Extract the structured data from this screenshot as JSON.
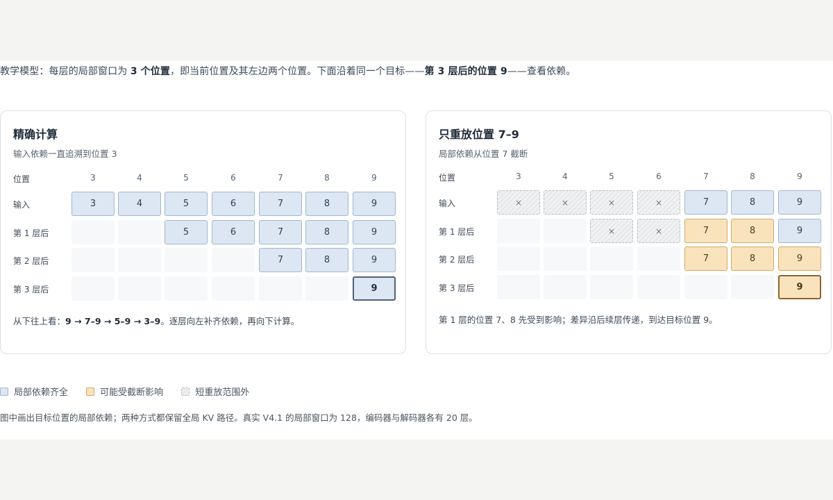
{
  "intro": {
    "p1": "教学模型：每层的局部窗口为 ",
    "b1": "3 个位置",
    "p2": "，即当前位置及其左边两个位置。下面沿着同一个目标——",
    "b2": "第 3 层后的位置 9",
    "p3": "——查看依赖。"
  },
  "column_header_label": "位置",
  "positions": [
    "3",
    "4",
    "5",
    "6",
    "7",
    "8",
    "9"
  ],
  "row_labels": [
    "输入",
    "第 1 层后",
    "第 2 层后",
    "第 3 层后"
  ],
  "panels": [
    {
      "title": "精确计算",
      "subtitle": "输入依赖一直追溯到位置 3",
      "grid": [
        [
          {
            "t": "blue",
            "v": "3"
          },
          {
            "t": "blue",
            "v": "4"
          },
          {
            "t": "blue",
            "v": "5"
          },
          {
            "t": "blue",
            "v": "6"
          },
          {
            "t": "blue",
            "v": "7"
          },
          {
            "t": "blue",
            "v": "8"
          },
          {
            "t": "blue",
            "v": "9"
          }
        ],
        [
          {
            "t": "empty",
            "v": ""
          },
          {
            "t": "empty",
            "v": ""
          },
          {
            "t": "blue",
            "v": "5"
          },
          {
            "t": "blue",
            "v": "6"
          },
          {
            "t": "blue",
            "v": "7"
          },
          {
            "t": "blue",
            "v": "8"
          },
          {
            "t": "blue",
            "v": "9"
          }
        ],
        [
          {
            "t": "empty",
            "v": ""
          },
          {
            "t": "empty",
            "v": ""
          },
          {
            "t": "empty",
            "v": ""
          },
          {
            "t": "empty",
            "v": ""
          },
          {
            "t": "blue",
            "v": "7"
          },
          {
            "t": "blue",
            "v": "8"
          },
          {
            "t": "blue",
            "v": "9"
          }
        ],
        [
          {
            "t": "empty",
            "v": ""
          },
          {
            "t": "empty",
            "v": ""
          },
          {
            "t": "empty",
            "v": ""
          },
          {
            "t": "empty",
            "v": ""
          },
          {
            "t": "empty",
            "v": ""
          },
          {
            "t": "empty",
            "v": ""
          },
          {
            "t": "target-blue",
            "v": "9"
          }
        ]
      ],
      "footer": {
        "p1": "从下往上看：",
        "b1": "9 → 7–9 → 5–9 → 3–9",
        "p2": "。逐层向左补齐依赖，再向下计算。"
      }
    },
    {
      "title": "只重放位置 7–9",
      "subtitle": "局部依赖从位置 7 截断",
      "grid": [
        [
          {
            "t": "hatch",
            "v": "×"
          },
          {
            "t": "hatch",
            "v": "×"
          },
          {
            "t": "hatch",
            "v": "×"
          },
          {
            "t": "hatch",
            "v": "×"
          },
          {
            "t": "blue",
            "v": "7"
          },
          {
            "t": "blue",
            "v": "8"
          },
          {
            "t": "blue",
            "v": "9"
          }
        ],
        [
          {
            "t": "empty",
            "v": ""
          },
          {
            "t": "empty",
            "v": ""
          },
          {
            "t": "hatch",
            "v": "×"
          },
          {
            "t": "hatch",
            "v": "×"
          },
          {
            "t": "orange",
            "v": "7"
          },
          {
            "t": "orange",
            "v": "8"
          },
          {
            "t": "blue",
            "v": "9"
          }
        ],
        [
          {
            "t": "empty",
            "v": ""
          },
          {
            "t": "empty",
            "v": ""
          },
          {
            "t": "empty",
            "v": ""
          },
          {
            "t": "empty",
            "v": ""
          },
          {
            "t": "orange",
            "v": "7"
          },
          {
            "t": "orange",
            "v": "8"
          },
          {
            "t": "orange",
            "v": "9"
          }
        ],
        [
          {
            "t": "empty",
            "v": ""
          },
          {
            "t": "empty",
            "v": ""
          },
          {
            "t": "empty",
            "v": ""
          },
          {
            "t": "empty",
            "v": ""
          },
          {
            "t": "empty",
            "v": ""
          },
          {
            "t": "empty",
            "v": ""
          },
          {
            "t": "target-orange",
            "v": "9"
          }
        ]
      ],
      "footer": {
        "p1": "第 1 层的位置 7、8 先受到影响；差异沿后续层传递，到达目标位置 9。",
        "b1": "",
        "p2": ""
      }
    }
  ],
  "legend": [
    "局部依赖齐全",
    "可能受截断影响",
    "短重放范围外"
  ],
  "note": "图中画出目标位置的局部依赖；两种方式都保留全局 KV 路径。真实 V4.1 的局部窗口为 128，编码器与解码器各有 20 层。",
  "colors": {
    "blue_fill": "#dce7f3",
    "orange_fill": "#f8e3bd",
    "hatch": "#e6e7e9"
  }
}
